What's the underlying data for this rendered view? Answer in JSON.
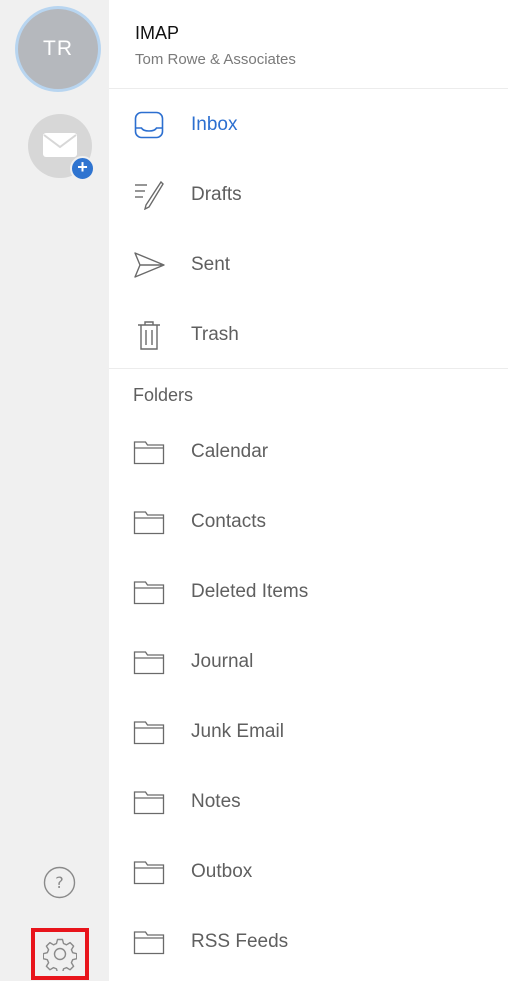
{
  "account": {
    "initials": "TR",
    "title": "IMAP",
    "subtitle": "Tom Rowe & Associates"
  },
  "rail": {
    "add_account_icon": "mail-plus-icon",
    "help_icon": "question-icon",
    "settings_icon": "gear-icon"
  },
  "mailboxes": [
    {
      "label": "Inbox",
      "icon": "inbox-icon",
      "active": true
    },
    {
      "label": "Drafts",
      "icon": "drafts-icon"
    },
    {
      "label": "Sent",
      "icon": "sent-icon"
    },
    {
      "label": "Trash",
      "icon": "trash-icon"
    }
  ],
  "folders_section": "Folders",
  "folders": [
    {
      "label": "Calendar"
    },
    {
      "label": "Contacts"
    },
    {
      "label": "Deleted Items"
    },
    {
      "label": "Journal"
    },
    {
      "label": "Junk Email"
    },
    {
      "label": "Notes"
    },
    {
      "label": "Outbox"
    },
    {
      "label": "RSS Feeds"
    }
  ],
  "colors": {
    "accent": "#2c6fd0",
    "rail_bg": "#f0f0f0",
    "highlight_box": "#e8141b"
  }
}
